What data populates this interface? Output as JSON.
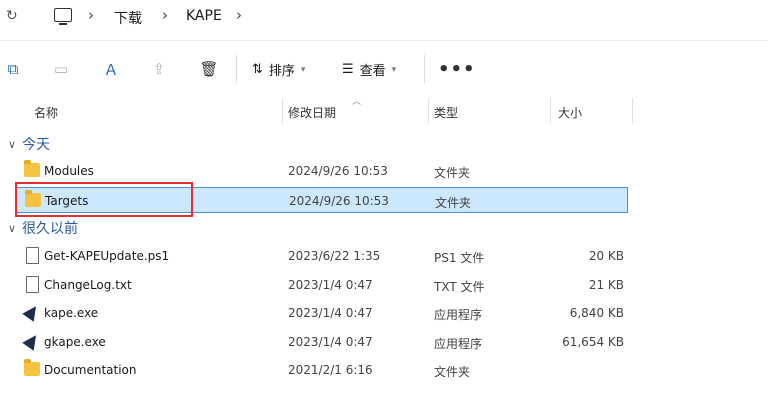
{
  "address": {
    "crumbs": [
      "下载",
      "KAPE"
    ]
  },
  "toolbar": {
    "sort_label": "排序",
    "view_label": "查看",
    "more_label": "•••"
  },
  "columns": {
    "name": "名称",
    "date": "修改日期",
    "type": "类型",
    "size": "大小"
  },
  "groups": {
    "today": "今天",
    "long_ago": "很久以前"
  },
  "files_today": [
    {
      "name": "Modules",
      "date": "2024/9/26 10:53",
      "type": "文件夹",
      "size": "",
      "icon": "folder-icon"
    },
    {
      "name": "Targets",
      "date": "2024/9/26 10:53",
      "type": "文件夹",
      "size": "",
      "icon": "folder-icon",
      "selected": true
    }
  ],
  "files_old": [
    {
      "name": "Get-KAPEUpdate.ps1",
      "date": "2023/6/22 1:35",
      "type": "PS1 文件",
      "size": "20 KB",
      "icon": "file-icon"
    },
    {
      "name": "ChangeLog.txt",
      "date": "2023/1/4 0:47",
      "type": "TXT 文件",
      "size": "21 KB",
      "icon": "file-icon"
    },
    {
      "name": "kape.exe",
      "date": "2023/1/4 0:47",
      "type": "应用程序",
      "size": "6,840 KB",
      "icon": "app-icon"
    },
    {
      "name": "gkape.exe",
      "date": "2023/1/4 0:47",
      "type": "应用程序",
      "size": "61,654 KB",
      "icon": "app-icon"
    },
    {
      "name": "Documentation",
      "date": "2021/2/1 6:16",
      "type": "文件夹",
      "size": "",
      "icon": "folder-icon"
    }
  ],
  "colors": {
    "selection": "#cce8ff",
    "selection_border": "#4c8ed8",
    "highlight": "#e23030",
    "group_text": "#2a5aa7"
  }
}
